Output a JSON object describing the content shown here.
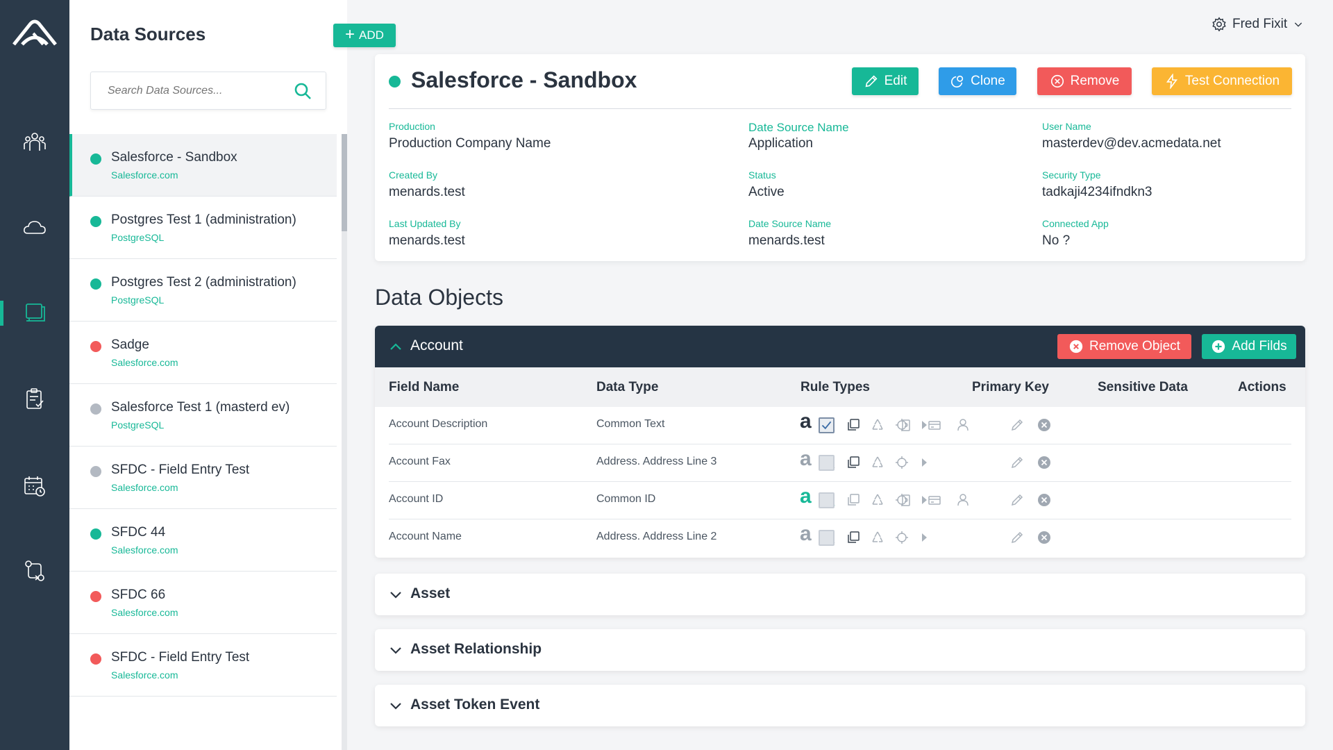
{
  "colors": {
    "accent": "#17b897",
    "rail": "#2b3a4a",
    "clone": "#2f9ce8",
    "remove": "#f25a5a",
    "test": "#fbb533",
    "inactive": "#b3b9c2"
  },
  "nav": {
    "items": [
      "users-icon",
      "cloud-icon",
      "data-sources-icon",
      "clipboard-check-icon",
      "calendar-clock-icon",
      "workflow-icon"
    ],
    "active": "data-sources-icon"
  },
  "sources_panel": {
    "title": "Data Sources",
    "add_label": "ADD",
    "search_placeholder": "Search Data Sources...",
    "items": [
      {
        "name": "Salesforce - Sandbox",
        "type": "Salesforce.com",
        "status": "green"
      },
      {
        "name": "Postgres Test 1 (administration)",
        "type": "PostgreSQL",
        "status": "green"
      },
      {
        "name": "Postgres Test 2 (administration)",
        "type": "PostgreSQL",
        "status": "green"
      },
      {
        "name": "Sadge",
        "type": "Salesforce.com",
        "status": "red"
      },
      {
        "name": "Salesforce Test 1 (masterd ev)",
        "type": "PostgreSQL",
        "status": "gray"
      },
      {
        "name": "SFDC - Field Entry Test",
        "type": "Salesforce.com",
        "status": "gray"
      },
      {
        "name": "SFDC 44",
        "type": "Salesforce.com",
        "status": "green"
      },
      {
        "name": "SFDC 66",
        "type": "Salesforce.com",
        "status": "red"
      },
      {
        "name": "SFDC - Field Entry Test",
        "type": "Salesforce.com",
        "status": "red"
      }
    ]
  },
  "user": {
    "name": "Fred Fixit"
  },
  "detail": {
    "title": "Salesforce - Sandbox",
    "buttons": {
      "edit": "Edit",
      "clone": "Clone",
      "remove": "Remove",
      "test": "Test Connection"
    },
    "fields": [
      {
        "label": "Production",
        "value": "Production Company Name"
      },
      {
        "label": "Date Source Name",
        "value": "Application"
      },
      {
        "label": "User Name",
        "value": "masterdev@dev.acmedata.net"
      },
      {
        "label": "Created By",
        "value": "menards.test"
      },
      {
        "label": "Status",
        "value": "Active"
      },
      {
        "label": "Security Type",
        "value": "tadkaji4234ifndkn3"
      },
      {
        "label": "Last Updated By",
        "value": "menards.test"
      },
      {
        "label": "Date Source Name",
        "value": "menards.test"
      },
      {
        "label": "Connected App",
        "value": "No ?"
      }
    ]
  },
  "data_objects": {
    "title": "Data Objects",
    "open_object": {
      "name": "Account",
      "remove_label": "Remove Object",
      "add_label": "Add Filds",
      "columns": [
        "Field Name",
        "Data Type",
        "Rule Types",
        "Primary Key",
        "Sensitive Data",
        "Actions"
      ],
      "rows": [
        {
          "field": "Account Description",
          "type": "Common Text",
          "primary_key": true,
          "rules_active": false,
          "sensitive": true
        },
        {
          "field": "Account Fax",
          "type": "Address. Address Line 3",
          "primary_key": false,
          "rules_active": false,
          "sensitive": false
        },
        {
          "field": "Account ID",
          "type": "Common ID",
          "primary_key": false,
          "rules_active": true,
          "sensitive": true
        },
        {
          "field": "Account Name",
          "type": "Address. Address Line 2",
          "primary_key": false,
          "rules_active": false,
          "sensitive": false
        }
      ]
    },
    "closed_objects": [
      "Asset",
      "Asset Relationship",
      "Asset Token Event"
    ]
  }
}
